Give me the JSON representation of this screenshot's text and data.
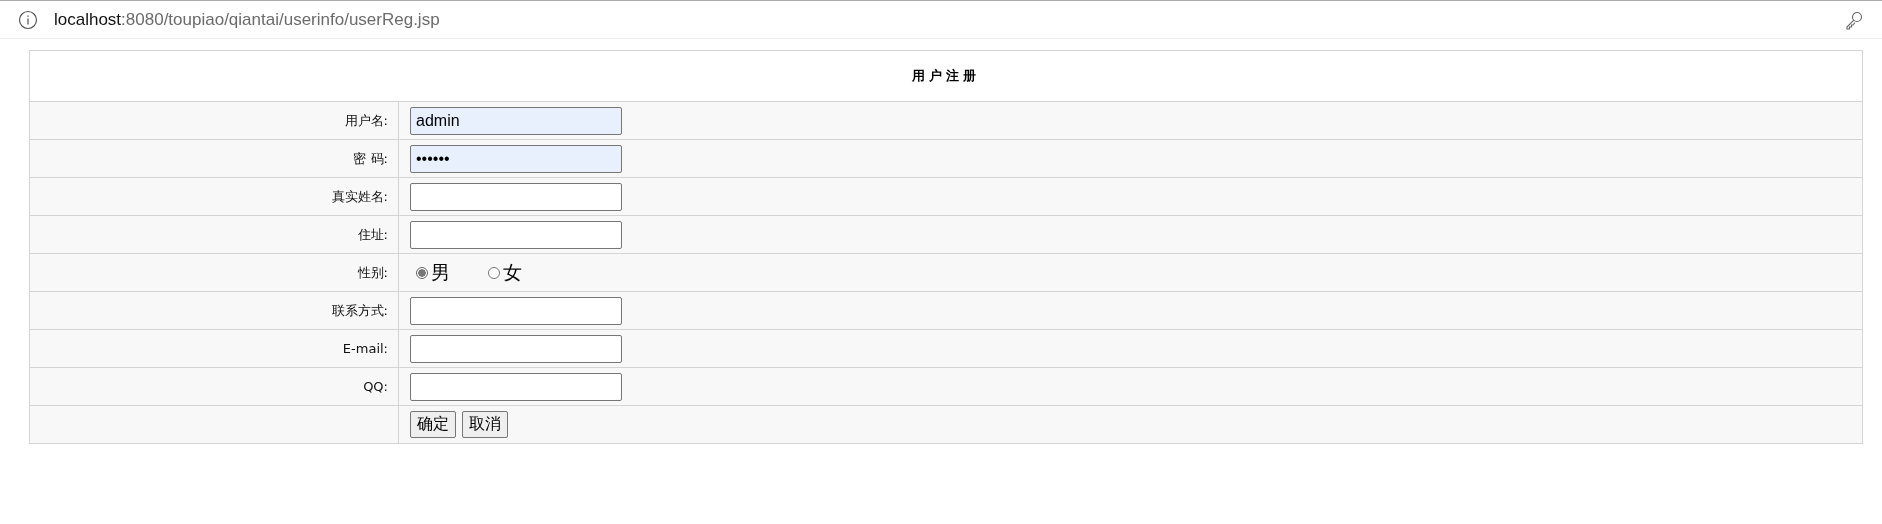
{
  "address_bar": {
    "host": "localhost",
    "path": ":8080/toupiao/qiantai/userinfo/userReg.jsp"
  },
  "form": {
    "title": "用户注册",
    "rows": [
      {
        "kind": "text",
        "label": "用户名:",
        "value": "admin",
        "autofilled": true
      },
      {
        "kind": "text",
        "label": "密 码:",
        "value": "••••••",
        "autofilled": true
      },
      {
        "kind": "text",
        "label": "真实姓名:",
        "autofilled": false
      },
      {
        "kind": "text",
        "label": "住址:",
        "autofilled": false
      },
      {
        "kind": "radio",
        "label": "性别:",
        "options": [
          {
            "label": "男",
            "selected": true
          },
          {
            "label": "女",
            "selected": false
          }
        ]
      },
      {
        "kind": "text",
        "label": "联系方式:",
        "autofilled": false
      },
      {
        "kind": "text",
        "label": "E-mail:",
        "autofilled": false
      },
      {
        "kind": "text",
        "label": "QQ:",
        "autofilled": false
      },
      {
        "kind": "buttons",
        "buttons": [
          "确定",
          "取消"
        ]
      }
    ]
  }
}
